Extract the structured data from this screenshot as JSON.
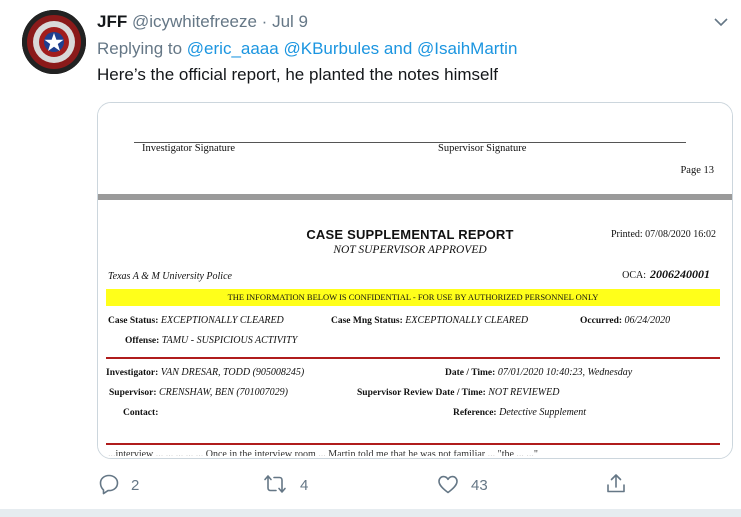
{
  "tweet": {
    "name": "JFF",
    "handle": "@icywhitefreeze",
    "separator": "·",
    "date": "Jul 9",
    "replying_prefix": "Replying to",
    "mention_1": "@eric_aaaa",
    "mention_2": "@KBurbules",
    "and_text": "and",
    "mention_3": "@IsaihMartin",
    "text": "Here’s the official report, he planted the notes himself"
  },
  "document": {
    "investigator_sig": "Investigator Signature",
    "supervisor_sig": "Supervisor Signature",
    "page": "Page 13",
    "title": "CASE SUPPLEMENTAL REPORT",
    "subtitle": "NOT SUPERVISOR APPROVED",
    "printed": "Printed: 07/08/2020  16:02",
    "department": "Texas A & M University Police",
    "oca_label": "OCA:",
    "oca_number": "2006240001",
    "confidential": "THE INFORMATION BELOW IS CONFIDENTIAL - FOR USE BY AUTHORIZED PERSONNEL ONLY",
    "case_status_label": "Case Status:",
    "case_status": "EXCEPTIONALLY CLEARED",
    "case_mng_label": "Case Mng Status:",
    "case_mng": "EXCEPTIONALLY CLEARED",
    "occurred_label": "Occurred:",
    "occurred": "06/24/2020",
    "offense_label": "Offense:",
    "offense": "TAMU - SUSPICIOUS ACTIVITY",
    "investigator_label": "Investigator:",
    "investigator": "VAN DRESAR, TODD     (905008245)",
    "datetime_label": "Date / Time:",
    "datetime": "07/01/2020 10:40:23, Wednesday",
    "supervisor_label": "Supervisor:",
    "supervisor": "CRENSHAW, BEN     (701007029)",
    "sup_review_label": "Supervisor Review Date / Time:",
    "sup_review": "NOT REVIEWED",
    "contact_label": "Contact:",
    "reference_label": "Reference:",
    "reference": "Detective Supplement",
    "cutoff_text": "...interview ... ... ... ... ...  Once in the interview room ... Martin told me that he was not familiar ... \"the ... ...\""
  },
  "actions": {
    "replies": "2",
    "retweets": "4",
    "likes": "43"
  },
  "colors": {
    "link": "#1b95e0",
    "muted": "#657786",
    "highlight": "#ffff1a",
    "rule_red": "#b01c1c"
  },
  "icons": [
    "captain-america-shield-avatar",
    "chevron-down-icon",
    "reply-icon",
    "retweet-icon",
    "like-icon",
    "share-icon"
  ]
}
